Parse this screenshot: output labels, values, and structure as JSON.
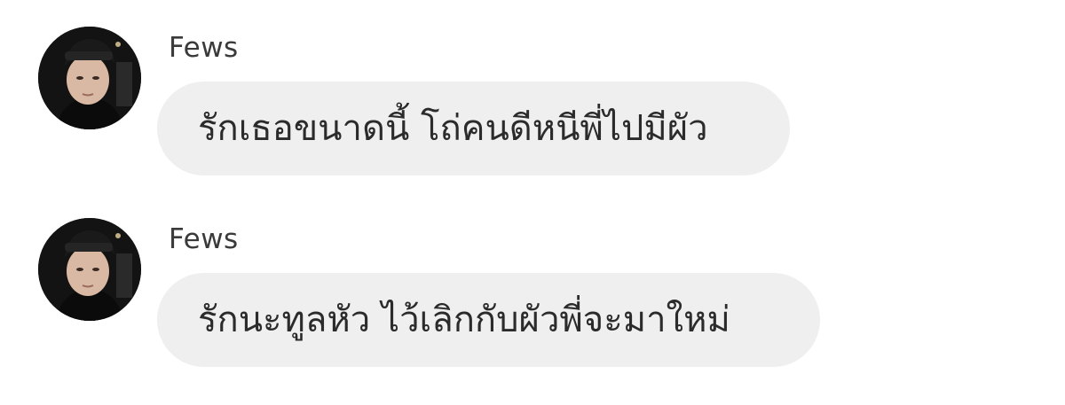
{
  "messages": [
    {
      "sender": "Fews",
      "text": "รักเธอขนาดนี้ โถ่คนดีหนีพี่ไปมีผัว",
      "avatar_icon": "profile-photo"
    },
    {
      "sender": "Fews",
      "text": "รักนะทูลหัว ไว้เลิกกับผัวพี่จะมาใหม่",
      "avatar_icon": "profile-photo"
    }
  ],
  "colors": {
    "background": "#ffffff",
    "bubble": "#efefef",
    "text": "#2b2b2b",
    "sender": "#3a3a3a"
  }
}
